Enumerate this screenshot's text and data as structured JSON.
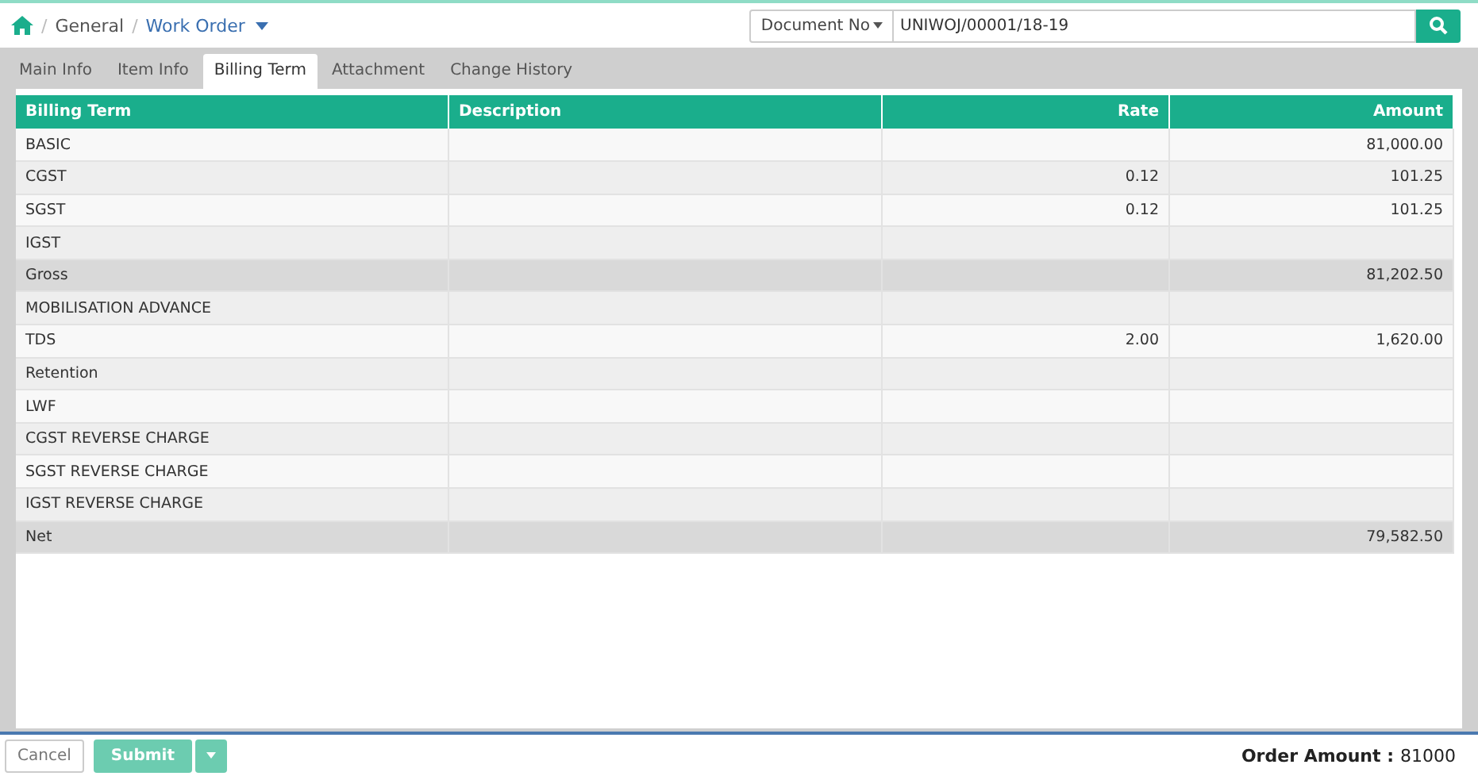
{
  "breadcrumb": {
    "separator": "/",
    "items": [
      "General"
    ],
    "current": "Work Order"
  },
  "search": {
    "filter": "Document No",
    "value": "UNIWOJ/00001/18-19"
  },
  "tabs": [
    {
      "label": "Main Info",
      "selected": false
    },
    {
      "label": "Item Info",
      "selected": false
    },
    {
      "label": "Billing Term",
      "selected": true
    },
    {
      "label": "Attachment",
      "selected": false
    },
    {
      "label": "Change History",
      "selected": false
    }
  ],
  "table": {
    "columns": [
      "Billing Term",
      "Description",
      "Rate",
      "Amount"
    ],
    "rows": [
      {
        "kind": "term",
        "cells": [
          "BASIC",
          "",
          "",
          "81,000.00"
        ]
      },
      {
        "kind": "term",
        "cells": [
          "CGST",
          "",
          "0.12",
          "101.25"
        ]
      },
      {
        "kind": "term",
        "cells": [
          "SGST",
          "",
          "0.12",
          "101.25"
        ]
      },
      {
        "kind": "term",
        "cells": [
          "IGST",
          "",
          "",
          ""
        ]
      },
      {
        "kind": "total",
        "cells": [
          "Gross",
          "",
          "",
          "81,202.50"
        ]
      },
      {
        "kind": "term",
        "cells": [
          "MOBILISATION ADVANCE",
          "",
          "",
          ""
        ]
      },
      {
        "kind": "term",
        "cells": [
          "TDS",
          "",
          "2.00",
          "1,620.00"
        ]
      },
      {
        "kind": "term",
        "cells": [
          "Retention",
          "",
          "",
          ""
        ]
      },
      {
        "kind": "term",
        "cells": [
          "LWF",
          "",
          "",
          ""
        ]
      },
      {
        "kind": "term",
        "cells": [
          "CGST REVERSE CHARGE",
          "",
          "",
          ""
        ]
      },
      {
        "kind": "term",
        "cells": [
          "SGST REVERSE CHARGE",
          "",
          "",
          ""
        ]
      },
      {
        "kind": "term",
        "cells": [
          "IGST REVERSE CHARGE",
          "",
          "",
          ""
        ]
      },
      {
        "kind": "total",
        "cells": [
          "Net",
          "",
          "",
          "79,582.50"
        ]
      }
    ]
  },
  "footer": {
    "buttons": [
      "Cancel",
      "Submit"
    ],
    "total_label": "Order Amount :",
    "total_value": "81000"
  }
}
